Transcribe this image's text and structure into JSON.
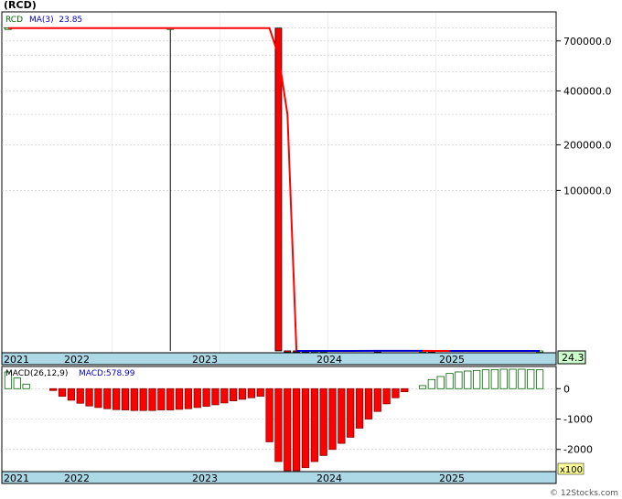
{
  "title": "(RCD)",
  "watermark": "© 12Stocks.com",
  "colors": {
    "axis_band": "#add8e6",
    "bear": "#ff0000",
    "bull_outline": "#006400",
    "ma_down": "#ff0000",
    "ma_up": "#0000cd",
    "grid": "#c8c8c8",
    "last_price_bg": "#ccffcc"
  },
  "price_panel": {
    "legend_symbol": "RCD",
    "legend_ma": "MA(3)  23.85",
    "last_price": "24.3",
    "y_scale": "log",
    "y_tick_labels": [
      "700000.0",
      "400000.0",
      "200000.0",
      "100000.0"
    ]
  },
  "macd_panel": {
    "legend_label": "MACD(26,12,9)",
    "legend_value": "MACD:578.99",
    "multiplier": "x100",
    "y_tick_labels": [
      "0",
      "-1000",
      "-2000"
    ]
  },
  "x_axis_labels": [
    "2021",
    "2022",
    "2023",
    "2024",
    "2025"
  ],
  "chart_data": [
    {
      "type": "candlestick",
      "title": "(RCD)",
      "y_scale": "log",
      "x_ticks": [
        "2021",
        "2022",
        "2023",
        "2024",
        "2025"
      ],
      "note": "monthly bars, Jan 2021 - Dec 2025; first bars are flat at ~800000 (no body); blue/red line is MA(3) 23.85",
      "series": [
        {
          "name": "RCD",
          "values": [
            {
              "month": "2021-01",
              "o": 800000,
              "h": 800000,
              "l": 800000,
              "c": 800000
            },
            {
              "month": "2022-07",
              "o": 800000,
              "h": 800000,
              "l": 35,
              "c": 800000
            },
            {
              "month": "2023-07",
              "o": 800000,
              "h": 800000,
              "l": 40,
              "c": 40
            },
            {
              "month": "2023-08",
              "o": 40,
              "h": 42,
              "l": 38,
              "c": 39
            },
            {
              "month": "2023-09",
              "o": 39,
              "h": 40,
              "l": 36,
              "c": 37
            },
            {
              "month": "2023-10",
              "o": 37,
              "h": 38,
              "l": 35,
              "c": 36
            },
            {
              "month": "2023-11",
              "o": 36,
              "h": 40,
              "l": 35,
              "c": 39
            },
            {
              "month": "2023-12",
              "o": 39,
              "h": 42,
              "l": 38,
              "c": 41
            },
            {
              "month": "2024-06",
              "o": 42,
              "h": 44,
              "l": 40,
              "c": 41
            },
            {
              "month": "2024-11",
              "o": 44,
              "h": 48,
              "l": 43,
              "c": 46
            },
            {
              "month": "2024-12",
              "o": 46,
              "h": 47,
              "l": 24,
              "c": 24
            },
            {
              "month": "2025-12",
              "o": 23,
              "h": 25,
              "l": 23,
              "c": 24.3
            }
          ]
        },
        {
          "name": "MA(3)",
          "values": [
            {
              "month": "2021-01",
              "v": 800000
            },
            {
              "month": "2023-06",
              "v": 800000
            },
            {
              "month": "2023-07",
              "v": 600000
            },
            {
              "month": "2023-08",
              "v": 300000
            },
            {
              "month": "2023-09",
              "v": 40
            },
            {
              "month": "2024-06",
              "v": 41
            },
            {
              "month": "2024-11",
              "v": 44
            },
            {
              "month": "2025-01",
              "v": 30
            },
            {
              "month": "2025-02",
              "v": 24
            },
            {
              "month": "2025-12",
              "v": 23.85
            }
          ]
        }
      ]
    },
    {
      "type": "bar",
      "title": "MACD(26,12,9)",
      "y_unit": "x100",
      "ylim": [
        -2700,
        700
      ],
      "note": "monthly MACD histogram; red = negative, green outline = positive",
      "categories": [
        "2021-01",
        "2021-02",
        "2021-03",
        "2021-04",
        "2021-05",
        "2021-06",
        "2021-07",
        "2021-08",
        "2021-09",
        "2021-10",
        "2021-11",
        "2021-12",
        "2022-01",
        "2022-02",
        "2022-03",
        "2022-04",
        "2022-05",
        "2022-06",
        "2022-07",
        "2022-08",
        "2022-09",
        "2022-10",
        "2022-11",
        "2022-12",
        "2023-01",
        "2023-02",
        "2023-03",
        "2023-04",
        "2023-05",
        "2023-06",
        "2023-07",
        "2023-08",
        "2023-09",
        "2023-10",
        "2023-11",
        "2023-12",
        "2024-01",
        "2024-02",
        "2024-03",
        "2024-04",
        "2024-05",
        "2024-06",
        "2024-07",
        "2024-08",
        "2024-09",
        "2024-10",
        "2024-11",
        "2024-12",
        "2025-01",
        "2025-02",
        "2025-03",
        "2025-04",
        "2025-05",
        "2025-06",
        "2025-07",
        "2025-08",
        "2025-09",
        "2025-10",
        "2025-11",
        "2025-12"
      ],
      "values": [
        550,
        350,
        150,
        0,
        0,
        -60,
        -250,
        -380,
        -480,
        -570,
        -620,
        -660,
        -690,
        -700,
        -720,
        -720,
        -720,
        -700,
        -700,
        -680,
        -660,
        -620,
        -580,
        -530,
        -470,
        -400,
        -350,
        -300,
        -250,
        -1750,
        -2400,
        -2700,
        -2700,
        -2600,
        -2400,
        -2200,
        -2000,
        -1800,
        -1600,
        -1300,
        -1000,
        -750,
        -500,
        -300,
        -100,
        0,
        100,
        300,
        400,
        500,
        550,
        580,
        600,
        620,
        630,
        640,
        640,
        640,
        630,
        620
      ]
    }
  ]
}
